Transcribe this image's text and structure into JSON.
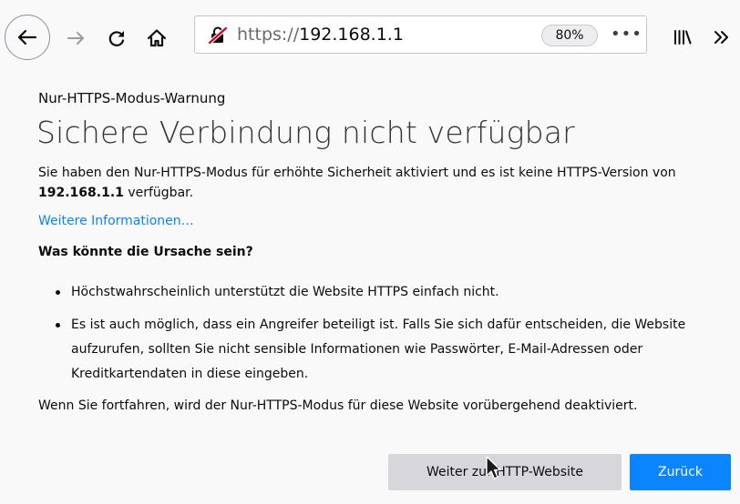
{
  "browser": {
    "url_scheme": "https://",
    "url_host": "192.168.1.1",
    "zoom": "80%",
    "page_actions_label": "•••",
    "icons": {
      "back": "back-arrow-icon",
      "forward": "forward-arrow-icon",
      "reload": "reload-icon",
      "home": "home-icon",
      "insecure": "insecure-connection-icon",
      "library": "library-icon",
      "overflow": "overflow-chevron-icon"
    }
  },
  "page": {
    "short_description": "Nur-HTTPS-Modus-Warnung",
    "title": "Sichere Verbindung nicht verfügbar",
    "intro_before": "Sie haben den Nur-HTTPS-Modus für erhöhte Sicherheit aktiviert und es ist keine HTTPS-Version von ",
    "intro_host": "192.168.1.1",
    "intro_after": " verfügbar.",
    "learn_more": "Weitere Informationen…",
    "what_heading": "Was könnte die Ursache sein?",
    "reasons": [
      "Höchstwahrscheinlich unterstützt die Website HTTPS einfach nicht.",
      "Es ist auch möglich, dass ein Angreifer beteiligt ist. Falls Sie sich dafür entscheiden, die Website aufzurufen, sollten Sie nicht sensible Informationen wie Passwörter, E-Mail-Adressen oder Kreditkartendaten in diese eingeben."
    ],
    "outro": "Wenn Sie fortfahren, wird der Nur-HTTPS-Modus für diese Website vorübergehend deaktiviert.",
    "continue_button": "Weiter zur HTTP-Website",
    "back_button": "Zurück"
  },
  "colors": {
    "background": "#f9f9fa",
    "link": "#0a84ff",
    "primary_button": "#0a84ff",
    "secondary_button": "#d7d7db",
    "insecure_icon": "#d70022"
  }
}
